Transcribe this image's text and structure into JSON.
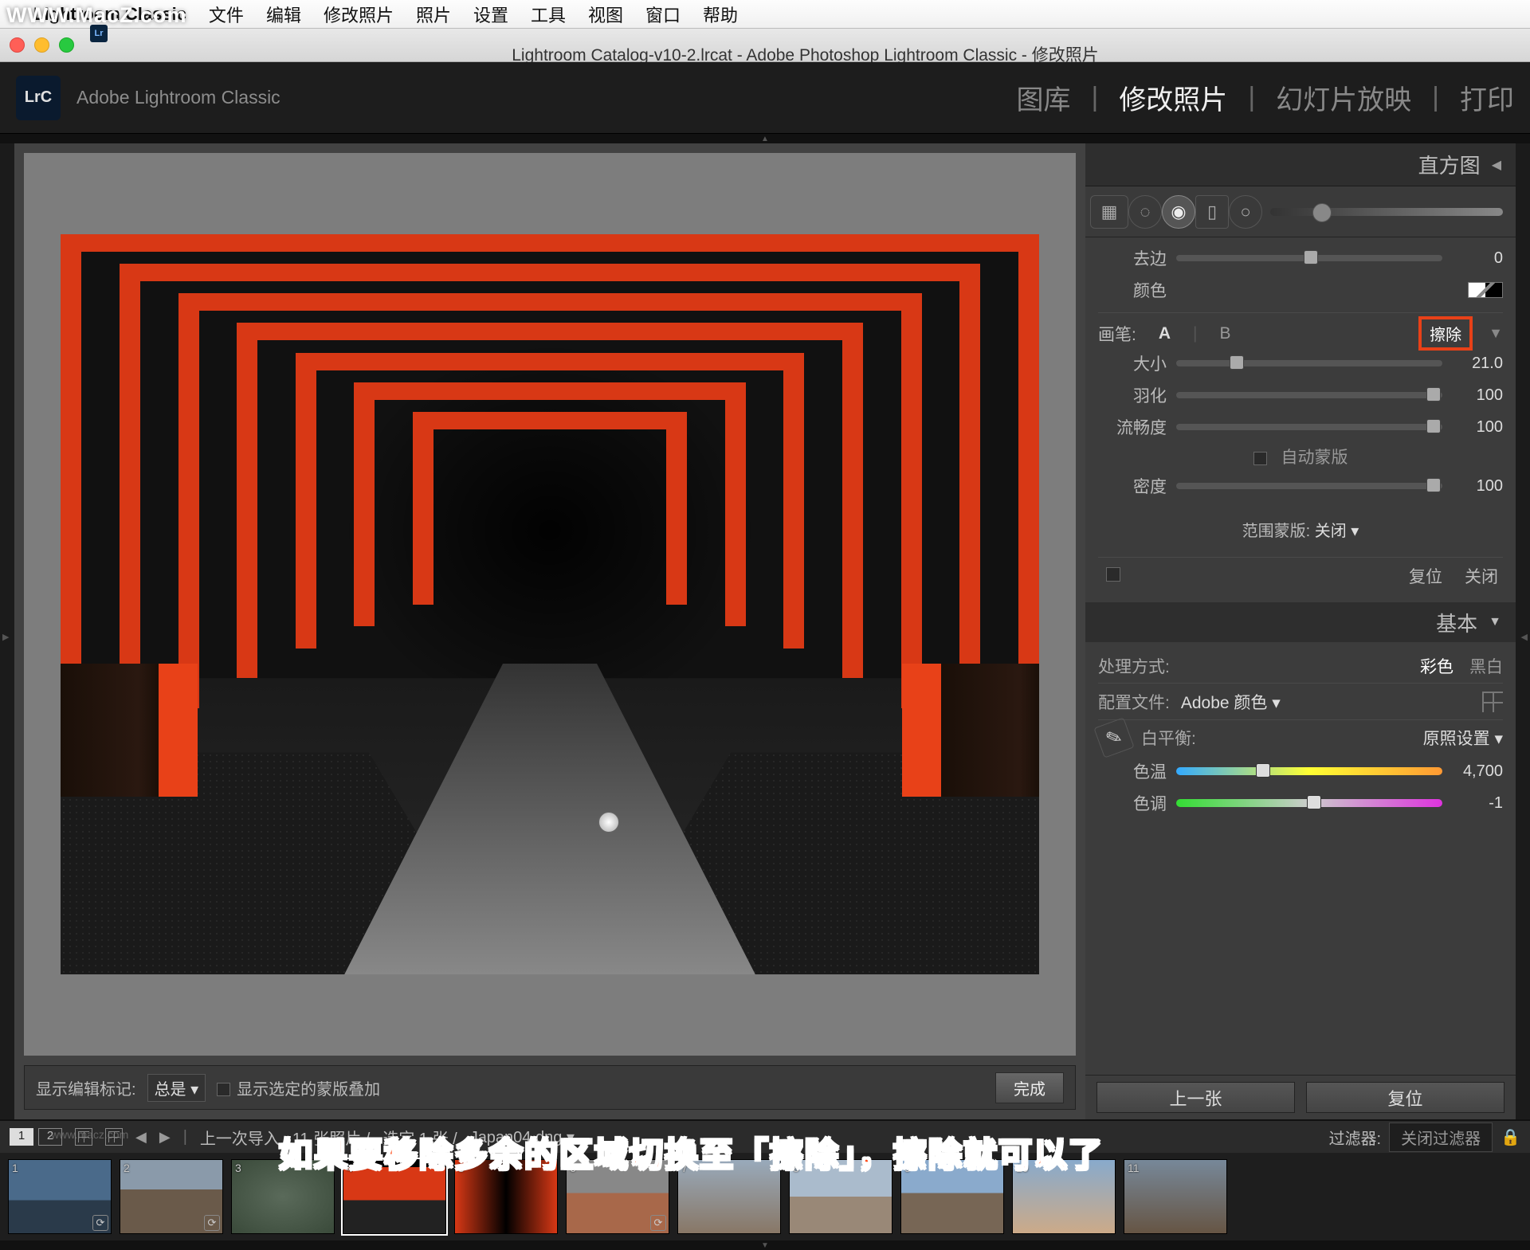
{
  "watermark": "WWW.MacZ.com",
  "macMenu": {
    "appName": "Lightroom Classic",
    "items": [
      "文件",
      "编辑",
      "修改照片",
      "照片",
      "设置",
      "工具",
      "视图",
      "窗口",
      "帮助"
    ]
  },
  "windowTitle": "Lightroom Catalog-v10-2.lrcat - Adobe Photoshop Lightroom Classic - 修改照片",
  "brand": "Adobe Lightroom Classic",
  "logoText": "LrC",
  "modules": {
    "library": "图库",
    "develop": "修改照片",
    "slideshow": "幻灯片放映",
    "print": "打印"
  },
  "histogram": {
    "title": "直方图"
  },
  "defringe": {
    "label": "去边",
    "value": "0"
  },
  "colorLabel": "颜色",
  "brush": {
    "label": "画笔:",
    "a": "A",
    "b": "B",
    "erase": "擦除",
    "size": {
      "label": "大小",
      "value": "21.0"
    },
    "feather": {
      "label": "羽化",
      "value": "100"
    },
    "flow": {
      "label": "流畅度",
      "value": "100"
    },
    "automask": "自动蒙版",
    "density": {
      "label": "密度",
      "value": "100"
    }
  },
  "rangeMask": {
    "label": "范围蒙版:",
    "value": "关闭"
  },
  "maskActions": {
    "reset": "复位",
    "close": "关闭"
  },
  "basic": {
    "title": "基本",
    "treatment": {
      "label": "处理方式:",
      "color": "彩色",
      "bw": "黑白"
    },
    "profile": {
      "label": "配置文件:",
      "value": "Adobe 颜色"
    },
    "wb": {
      "label": "白平衡:",
      "value": "原照设置"
    },
    "temp": {
      "label": "色温",
      "value": "4,700"
    },
    "tint": {
      "label": "色调",
      "value": "-1"
    }
  },
  "nav": {
    "prev": "上一张",
    "reset": "复位"
  },
  "canvasToolbar": {
    "showEdit": "显示编辑标记:",
    "always": "总是",
    "overlay": "显示选定的蒙版叠加",
    "done": "完成"
  },
  "filmstripBar": {
    "one": "1",
    "two": "2",
    "lastImport": "上一次导入",
    "count": "11 张照片 /",
    "selected": "选定 1 张 /",
    "filename": "Japan04.dng",
    "filterLabel": "过滤器:",
    "filterValue": "关闭过滤器"
  },
  "thumbs": [
    "1",
    "2",
    "3",
    "4",
    "5",
    "6",
    "7",
    "8",
    "9",
    "10",
    "11"
  ],
  "annotation": "如果要移除多余的区域切换至「擦除」，擦除就可以了",
  "thumbWatermark": "www.macz.com"
}
